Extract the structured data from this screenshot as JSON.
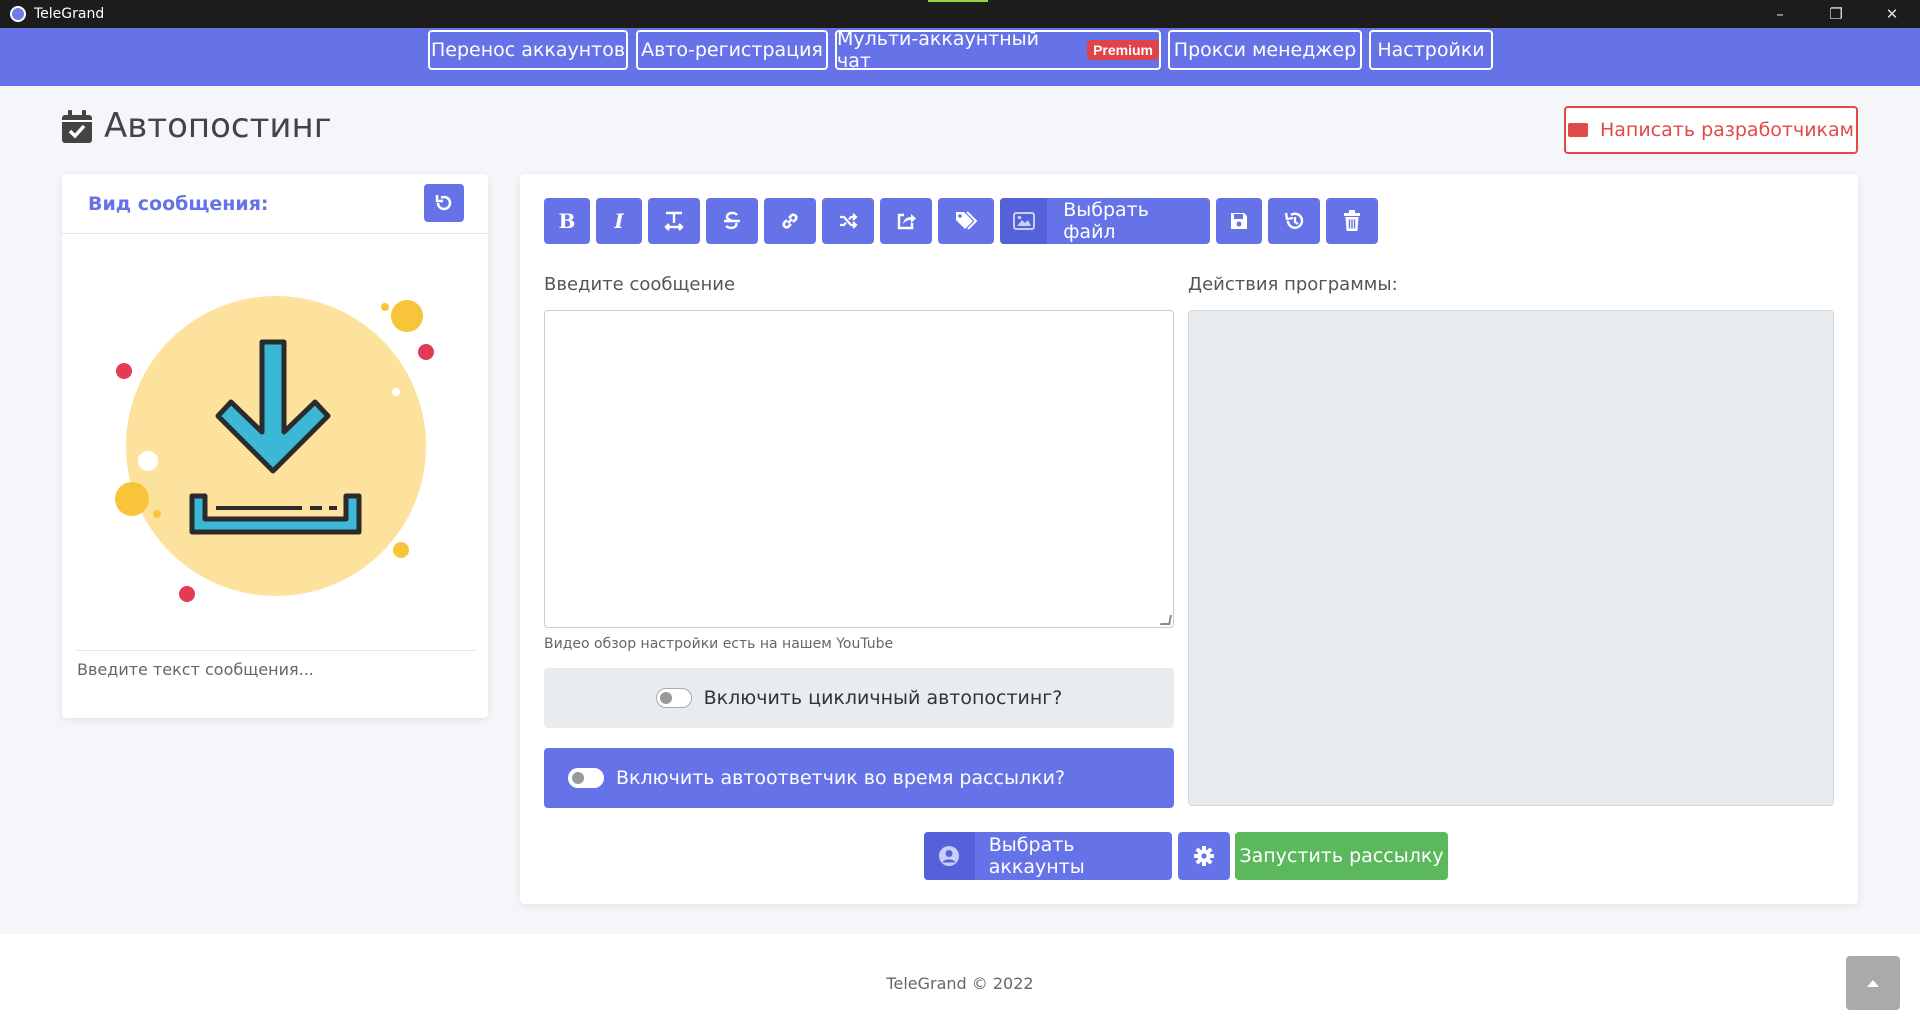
{
  "window": {
    "title": "TeleGrand",
    "minimize_glyph": "–",
    "maximize_glyph": "❐",
    "close_glyph": "✕"
  },
  "nav": {
    "items": [
      {
        "label": "Перенос аккаунтов"
      },
      {
        "label": "Авто-регистрация"
      },
      {
        "label": "Мульти-аккаунтный чат",
        "badge": "Premium"
      },
      {
        "label": "Прокси менеджер"
      },
      {
        "label": "Настройки"
      }
    ]
  },
  "page": {
    "title": "Автопостинг",
    "title_icon": "calendar-check-icon"
  },
  "contact_button": {
    "label": "Написать разработчикам",
    "icon": "envelope-icon"
  },
  "preview": {
    "header": "Вид сообщения:",
    "reset_icon": "undo-icon",
    "image_icon": "download-illustration-icon",
    "placeholder_text": "Введите текст сообщения..."
  },
  "toolbar": {
    "bold": "B",
    "italic": "I",
    "file_button": "Выбрать файл",
    "icons": [
      "bold-icon",
      "italic-icon",
      "text-height-icon",
      "strikethrough-icon",
      "link-icon",
      "random-icon",
      "share-icon",
      "tags-icon",
      "image-icon",
      "save-icon",
      "history-icon",
      "trash-icon"
    ]
  },
  "editor": {
    "message_label": "Введите сообщение",
    "message_value": "",
    "actions_label": "Действия программы:",
    "hint": "Видео обзор настройки есть на нашем YouTube"
  },
  "toggles": {
    "cyclic_label": "Включить цикличный автопостинг?",
    "cyclic_on": false,
    "autoreply_label": "Включить автоответчик во время рассылки?",
    "autoreply_on": false
  },
  "bottom_actions": {
    "select_accounts": "Выбрать аккаунты",
    "settings_icon": "gear-icon",
    "start": "Запустить рассылку"
  },
  "footer": {
    "text": "TeleGrand © 2022",
    "scroll_top_icon": "caret-up-icon"
  },
  "colors": {
    "primary": "#6673e8",
    "danger": "#e04a4a",
    "success": "#5cb85c",
    "badge": "#e0434a"
  }
}
